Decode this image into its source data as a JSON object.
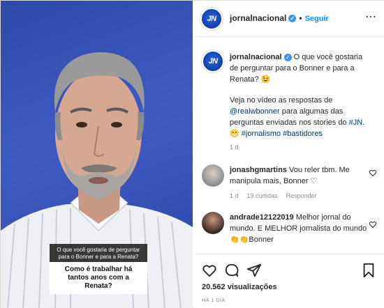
{
  "colors": {
    "accent": "#0095f6",
    "brand_blue": "#1446b3",
    "muted": "#8e8e8e"
  },
  "video": {
    "overlay_question": "O que você gostaria de perguntar para o Bonner e para a Renata?",
    "overlay_answer": "Como é trabalhar há tantos anos com a Renata?"
  },
  "header": {
    "username": "jornalnacional",
    "separator": "•",
    "follow_label": "Seguir",
    "avatar_text": "JN",
    "more_icon": "more-icon"
  },
  "caption": {
    "username": "jornalnacional",
    "line1": "O que você gostaria de perguntar para o Bonner e para a Renata? 😉",
    "line2_pre": "Veja no vídeo as respostas de ",
    "mention": "@realwbonner",
    "line2_post": " para algumas das perguntas enviadas nos stories do ",
    "tag_jn": "#JN.",
    "emoji": " 😁 ",
    "tag1": "#jornalismo",
    "tag2": "#bastidores",
    "age": "1 d"
  },
  "comments": [
    {
      "username": "jonashgmartins",
      "text": "Vou reler tbm. Me manipula mais, Bonner ♡",
      "age": "1 d",
      "likes": "19 curtidas",
      "reply": "Responder"
    },
    {
      "username": "andrade12122019",
      "text": "Melhor jornal do mundo. E MELHOR jornalista do mundo 👏👏Bonner"
    }
  ],
  "actions": {
    "views": "20.562 visualizações",
    "time": "HÁ 1 DIA"
  }
}
